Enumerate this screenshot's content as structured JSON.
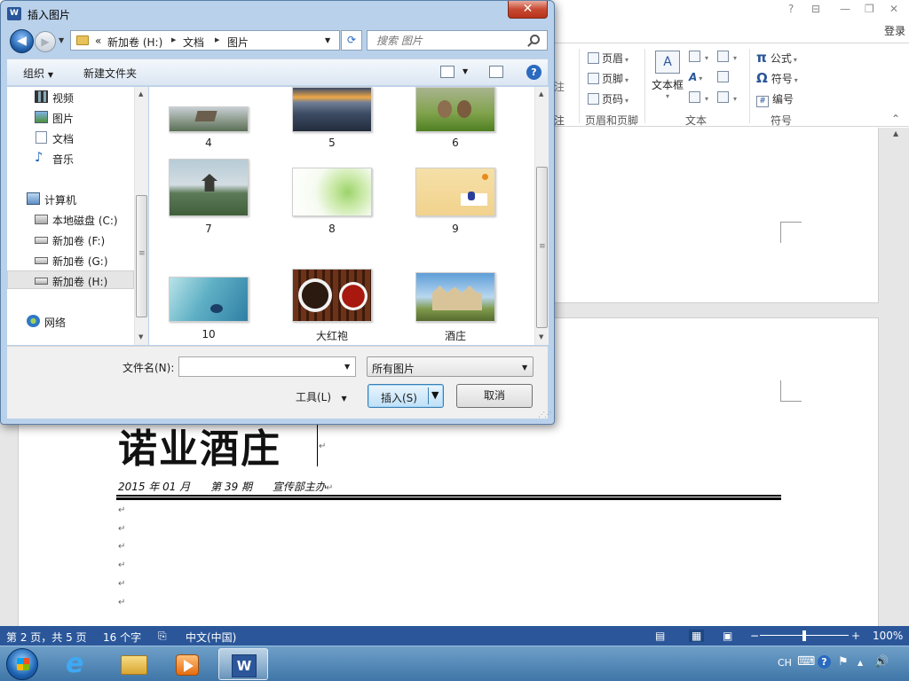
{
  "dialog": {
    "title": "插入图片",
    "close_glyph": "✕",
    "nav": {
      "back_glyph": "◀",
      "forward_glyph": "▶",
      "history_glyph": "▼",
      "refresh_glyph": "⟳"
    },
    "address": {
      "overflow": "«",
      "segments": [
        "新加卷 (H:)",
        "文档",
        "图片"
      ],
      "sep_glyph": "▶",
      "drop_glyph": "▼"
    },
    "search_placeholder": "搜索 图片",
    "toolbar": {
      "organize": "组织",
      "organize_arrow": "▼",
      "new_folder": "新建文件夹",
      "view_arrow": "▼",
      "help": "?"
    },
    "nav_pane": {
      "items": [
        {
          "label": "视频"
        },
        {
          "label": "图片"
        },
        {
          "label": "文档"
        },
        {
          "label": "音乐"
        },
        {
          "label": "计算机"
        },
        {
          "label": "本地磁盘 (C:)"
        },
        {
          "label": "新加卷 (F:)"
        },
        {
          "label": "新加卷 (G:)"
        },
        {
          "label": "新加卷 (H:)"
        },
        {
          "label": "网络"
        }
      ],
      "selected": "新加卷 (H:)"
    },
    "scroll": {
      "up_glyph": "▲",
      "down_glyph": "▼",
      "grip_glyph": "≡"
    },
    "files": [
      {
        "name": "4"
      },
      {
        "name": "5"
      },
      {
        "name": "6"
      },
      {
        "name": "7"
      },
      {
        "name": "8"
      },
      {
        "name": "9"
      },
      {
        "name": "10"
      },
      {
        "name": "大红袍"
      },
      {
        "name": "酒庄"
      }
    ],
    "filename_label": "文件名(N):",
    "filename_value": "",
    "filename_drop": "▼",
    "filter": {
      "value": "所有图片",
      "drop_glyph": "▼"
    },
    "tools_label": "工具(L)",
    "tools_arrow": "▼",
    "insert_label": "插入(S)",
    "insert_drop": "▼",
    "cancel_label": "取消",
    "grip": "⋰⋰"
  },
  "word": {
    "title_buttons": {
      "help": "?",
      "ribbon_display": "⊟",
      "minimize": "—",
      "restore": "❐",
      "close": "✕"
    },
    "login": "登录",
    "ribbon": {
      "partial_label_1": "注",
      "partial_label_2": "注",
      "header": "页眉",
      "footer": "页脚",
      "page_number": "页码",
      "group_header_footer": "页眉和页脚",
      "text_box": "文本框",
      "group_text": "文本",
      "equation": "公式",
      "symbol": "符号",
      "numbering": "编号",
      "group_symbols": "符号",
      "pi_glyph": "π",
      "omega_glyph": "Ω",
      "dropdown_glyph": "▾",
      "text_box_glyph": "A",
      "wordart_glyph": "A",
      "numbering_glyph": "#",
      "collapse_glyph": "⌃"
    },
    "doc": {
      "title": "诺业酒庄",
      "subtitle": "2015 年 01 月      第 39 期      宣传部主办",
      "para_mark": "↵",
      "scroll_up": "▲"
    },
    "status": {
      "page": "第 2 页，共 5 页",
      "words": "16 个字",
      "lang_icon": "⎘",
      "language": "中文(中国)",
      "view_read": "▤",
      "view_print": "▦",
      "view_web": "▣",
      "zoom_minus": "−",
      "zoom_plus": "+",
      "zoom": "100%"
    }
  },
  "taskbar": {
    "ie_glyph": "e",
    "word_glyph": "W",
    "tray": {
      "lang": "CH",
      "keyboard": "⌨",
      "help": "?",
      "flag": "⚑",
      "up": "▲",
      "volume": "🔊"
    }
  }
}
